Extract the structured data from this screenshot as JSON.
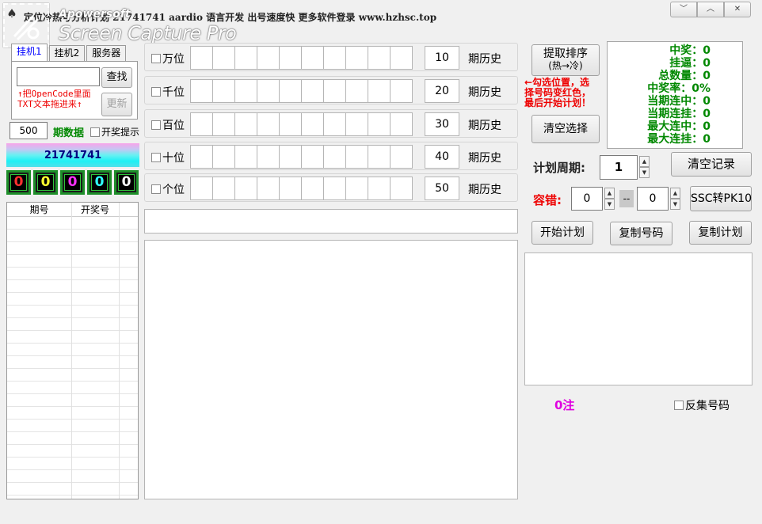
{
  "window": {
    "title": "定位冷热号分析计划 21741741  aardio 语言开发  出号速度快  更多软件登录  www.hzhsc.top",
    "watermark_small": "Apowersoft",
    "watermark_big": "Screen Capture Pro",
    "controls": [
      "﹀",
      "︿",
      "✕"
    ]
  },
  "left": {
    "tabs": [
      "挂机1",
      "挂机2",
      "服务器"
    ],
    "search_value": "",
    "search_button": "查找",
    "note_line1": "↑把OpenCode里面",
    "note_line2": "TXT文本拖进来↑",
    "update_button": "更新",
    "period_count": "500",
    "period_data_label": "期数据",
    "draw_prompt_label": "开奖提示",
    "issue_banner": "21741741",
    "digits": [
      {
        "value": "0",
        "color": "#ff3030"
      },
      {
        "value": "0",
        "color": "#ffff30"
      },
      {
        "value": "0",
        "color": "#ff30ff"
      },
      {
        "value": "0",
        "color": "#30ffff"
      },
      {
        "value": "0",
        "color": "#ffffff"
      }
    ],
    "table_headers": [
      "期号",
      "开奖号"
    ]
  },
  "positions": [
    {
      "label": "万位",
      "period": "10",
      "suffix": "期历史"
    },
    {
      "label": "千位",
      "period": "20",
      "suffix": "期历史"
    },
    {
      "label": "百位",
      "period": "30",
      "suffix": "期历史"
    },
    {
      "label": "十位",
      "period": "40",
      "suffix": "期历史"
    },
    {
      "label": "个位",
      "period": "50",
      "suffix": "期历史"
    }
  ],
  "right": {
    "sort_button_line1": "提取排序",
    "sort_button_line2": "(热→冷)",
    "red_note_line1": "←勾选位置，选",
    "red_note_line2": "择号码变红色，",
    "red_note_line3": "最后开始计划！",
    "clear_select_button": "清空选择",
    "stats": [
      "中奖：0",
      "挂逼：0",
      "总数量：0",
      "中奖率：0%",
      "当期连中：0",
      "当期连挂：0",
      "最大连中：0",
      "最大连挂：0"
    ],
    "plan_period_label": "计划周期:",
    "plan_period_value": "1",
    "clear_record_button": "清空记录",
    "tolerance_label": "容错:",
    "tolerance_from": "0",
    "tolerance_sep": "--",
    "tolerance_to": "0",
    "ssc_button": "SSC转PK10",
    "start_plan_button": "开始计划",
    "copy_numbers_button": "复制号码",
    "copy_plan_button": "复制计划",
    "count_text": "0注",
    "reverse_label": "反集号码"
  },
  "colors": {
    "stats_green": "#008000",
    "note_red": "#e00000",
    "count_magenta": "#e000e0",
    "banner_text": "#000080"
  }
}
